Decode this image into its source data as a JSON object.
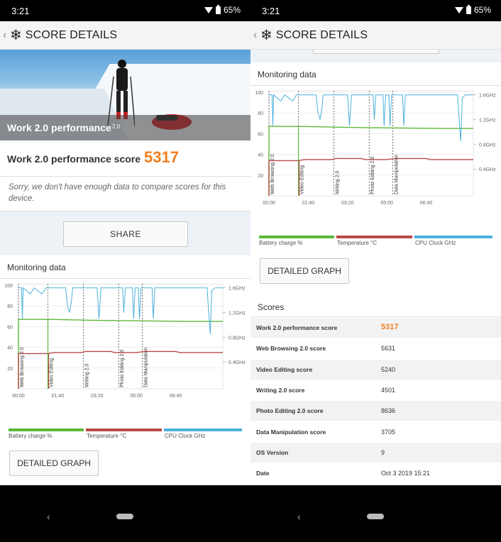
{
  "status": {
    "time": "3:21",
    "battery": "65%"
  },
  "appbar": {
    "title": "SCORE DETAILS",
    "icon": "snowflake-icon"
  },
  "hero": {
    "title": "Work 2.0 performance",
    "subtitle": "2.0"
  },
  "score": {
    "label": "Work 2.0 performance score",
    "value": "5317"
  },
  "compare_msg": "Sorry, we don't have enough data to compare scores for this device.",
  "share_label": "SHARE",
  "monitoring": {
    "title": "Monitoring data",
    "detail_label": "DETAILED GRAPH",
    "legend": [
      "Battery charge %",
      "Temperature °C",
      "CPU Clock GHz"
    ]
  },
  "colors": {
    "accent": "#f07f22",
    "battery": "#5cb83a",
    "temperature": "#b94a48",
    "cpu": "#4ab0dc"
  },
  "chart_data": {
    "type": "line",
    "x_ticks": [
      "00:00",
      "01:40",
      "03:20",
      "05:00",
      "06:40"
    ],
    "y_ticks": [
      20,
      40,
      60,
      80,
      100
    ],
    "y2_ticks": [
      "0.4GHz",
      "0.8GHz",
      "1.2GHz",
      "1.6GHz"
    ],
    "ylim": [
      0,
      100
    ],
    "xlim_seconds": [
      0,
      520
    ],
    "sections": [
      {
        "name": "Web Browsing 2.0",
        "start": 0
      },
      {
        "name": "Video Editing",
        "start": 75
      },
      {
        "name": "Writing 2.0",
        "start": 165
      },
      {
        "name": "Photo Editing 2.0",
        "start": 255
      },
      {
        "name": "Data Manipulation",
        "start": 315
      }
    ],
    "series": [
      {
        "name": "Battery charge %",
        "values": [
          [
            0,
            67
          ],
          [
            80,
            67
          ],
          [
            200,
            66
          ],
          [
            440,
            65
          ],
          [
            520,
            65
          ]
        ]
      },
      {
        "name": "Temperature °C",
        "values": [
          [
            0,
            34
          ],
          [
            75,
            34
          ],
          [
            90,
            35
          ],
          [
            160,
            35
          ],
          [
            170,
            36
          ],
          [
            235,
            36
          ],
          [
            245,
            35
          ],
          [
            300,
            35
          ],
          [
            320,
            36
          ],
          [
            400,
            36
          ],
          [
            410,
            35
          ],
          [
            520,
            35
          ]
        ]
      },
      {
        "name": "CPU Clock GHz",
        "values": [
          [
            0,
            1.6
          ],
          [
            8,
            1.6
          ],
          [
            10,
            1.1
          ],
          [
            12,
            1.6
          ],
          [
            30,
            1.5
          ],
          [
            40,
            1.6
          ],
          [
            60,
            1.5
          ],
          [
            70,
            1.6
          ],
          [
            120,
            1.6
          ],
          [
            125,
            1.3
          ],
          [
            130,
            1.2
          ],
          [
            135,
            1.4
          ],
          [
            138,
            1.6
          ],
          [
            200,
            1.6
          ],
          [
            205,
            1.1
          ],
          [
            210,
            1.6
          ],
          [
            265,
            1.6
          ],
          [
            268,
            1.2
          ],
          [
            272,
            1.6
          ],
          [
            290,
            1.6
          ],
          [
            293,
            1.1
          ],
          [
            297,
            1.6
          ],
          [
            305,
            1.6
          ],
          [
            308,
            1.1
          ],
          [
            312,
            1.6
          ],
          [
            340,
            1.6
          ],
          [
            343,
            1.1
          ],
          [
            347,
            1.6
          ],
          [
            480,
            1.6
          ],
          [
            484,
            1.2
          ],
          [
            488,
            0.85
          ],
          [
            492,
            1.55
          ],
          [
            500,
            1.6
          ],
          [
            520,
            1.6
          ]
        ]
      }
    ]
  },
  "scores": {
    "title": "Scores",
    "rows": [
      {
        "label": "Work 2.0 performance score",
        "value": "5317"
      },
      {
        "label": "Web Browsing 2.0 score",
        "value": "5631"
      },
      {
        "label": "Video Editing score",
        "value": "5240"
      },
      {
        "label": "Writing 2.0 score",
        "value": "4501"
      },
      {
        "label": "Photo Editing 2.0 score",
        "value": "8636"
      },
      {
        "label": "Data Manipulation score",
        "value": "3705"
      },
      {
        "label": "OS Version",
        "value": "9"
      },
      {
        "label": "Date",
        "value": "Oct 3 2019 15:21"
      }
    ]
  }
}
